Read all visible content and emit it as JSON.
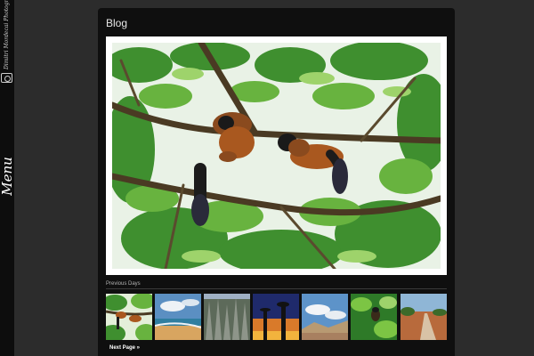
{
  "sidebar": {
    "logo_text": "Dimitri Mordecai Photography",
    "menu_label": "Menu"
  },
  "blog": {
    "title": "Blog",
    "featured_alt": "Two red ruffed lemurs hanging from branches among green leaves"
  },
  "previous_days": {
    "label": "Previous Days",
    "thumbnails": [
      {
        "name": "lemurs",
        "alt": "Lemurs in tree"
      },
      {
        "name": "beach",
        "alt": "Beach and sea"
      },
      {
        "name": "rock-forest",
        "alt": "Rock forest"
      },
      {
        "name": "baobabs-sunset",
        "alt": "Baobabs at sunset"
      },
      {
        "name": "desert-clouds",
        "alt": "Desert under clouds"
      },
      {
        "name": "jungle-lemur",
        "alt": "Lemur in jungle"
      },
      {
        "name": "red-road",
        "alt": "Red dirt road"
      }
    ],
    "next_label": "Next Page »"
  },
  "colors": {
    "background": "#2c2c2c",
    "panel": "#0f0f0f",
    "sidebar": "#0d0d0d"
  }
}
